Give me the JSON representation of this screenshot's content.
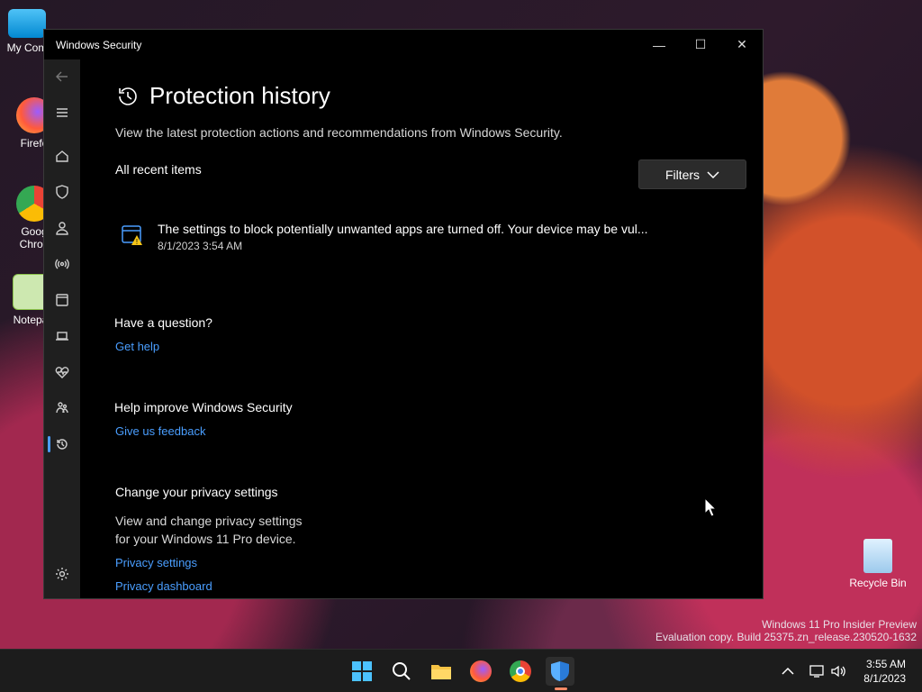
{
  "desktop": {
    "icons": [
      {
        "label": "My Com"
      },
      {
        "label": "Firefo"
      },
      {
        "label": "Goog\nChron"
      },
      {
        "label": "Notepa"
      },
      {
        "label": "Recycle Bin"
      }
    ],
    "watermark_line1": "Windows 11 Pro Insider Preview",
    "watermark_line2": "Evaluation copy. Build 25375.zn_release.230520-1632"
  },
  "window": {
    "title": "Windows Security",
    "minimize": "—",
    "maximize": "☐",
    "close": "✕"
  },
  "page": {
    "title": "Protection history",
    "subtitle": "View the latest protection actions and recommendations from Windows Security.",
    "recent_label": "All recent items",
    "filters_label": "Filters"
  },
  "history_items": [
    {
      "message": "The settings to block potentially unwanted apps are turned off. Your device may be vul...",
      "timestamp": "8/1/2023 3:54 AM"
    }
  ],
  "help": {
    "question_heading": "Have a question?",
    "get_help": "Get help",
    "improve_heading": "Help improve Windows Security",
    "feedback": "Give us feedback",
    "privacy_heading": "Change your privacy settings",
    "privacy_text_1": "View and change privacy settings",
    "privacy_text_2": "for your Windows 11 Pro device.",
    "privacy_settings": "Privacy settings",
    "privacy_dashboard": "Privacy dashboard"
  },
  "taskbar": {
    "time": "3:55 AM",
    "date": "8/1/2023"
  },
  "colors": {
    "accent": "#4a9eff",
    "sidebar": "#1f1f1f",
    "window_bg": "#000000"
  }
}
